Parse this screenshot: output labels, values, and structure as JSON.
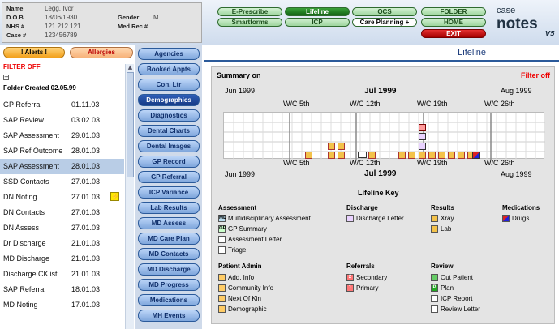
{
  "patient": {
    "name_label": "Name",
    "name": "Legg, Ivor",
    "dob_label": "D.O.B",
    "dob": "18/06/1930",
    "gender_label": "Gender",
    "gender": "M",
    "nhs_label": "NHS #",
    "nhs": "121 212 121",
    "medrec_label": "Med Rec #",
    "medrec": "",
    "case_label": "Case #",
    "case": "123456789"
  },
  "toolbar": {
    "eprescribe": "E-Prescribe",
    "lifeline": "Lifeline",
    "ocs": "OCS",
    "folder": "FOLDER",
    "smartforms": "Smartforms",
    "icp": "ICP",
    "care_planning": "Care Planning +",
    "home": "HOME",
    "exit": "EXIT"
  },
  "logo": {
    "text1": "case",
    "text2": "notes",
    "version": "V5"
  },
  "left": {
    "alerts": "! Alerts !",
    "allergies": "Allergies",
    "filter_off": "FILTER OFF",
    "collapse": "−",
    "folder_created": "Folder Created 02.05.99"
  },
  "list": [
    {
      "title": "GP Referral",
      "date": "01.11.03"
    },
    {
      "title": "SAP Review",
      "date": "03.02.03"
    },
    {
      "title": "SAP Assessment",
      "date": "29.01.03"
    },
    {
      "title": "SAP Ref Outcome",
      "date": "28.01.03"
    },
    {
      "title": "SAP Assessment",
      "date": "28.01.03"
    },
    {
      "title": "SSD Contacts",
      "date": "27.01.03"
    },
    {
      "title": "DN Noting",
      "date": "27.01.03",
      "icon": "alert-icon"
    },
    {
      "title": "DN Contacts",
      "date": "27.01.03"
    },
    {
      "title": "DN Assess",
      "date": "27.01.03"
    },
    {
      "title": "Dr Discharge",
      "date": "21.01.03"
    },
    {
      "title": "MD Discharge",
      "date": "21.01.03"
    },
    {
      "title": "Discharge CKlist",
      "date": "21.01.03"
    },
    {
      "title": "SAP Referral",
      "date": "18.01.03"
    },
    {
      "title": "MD Noting",
      "date": "17.01.03"
    },
    {
      "title": "",
      "date": ""
    }
  ],
  "nav": [
    "Agencies",
    "Booked Appts",
    "Con. Ltr",
    "Demographics",
    "Diagnostics",
    "Dental Charts",
    "Dental Images",
    "GP Record",
    "GP Referral",
    "ICP Variance",
    "Lab Results",
    "MD Assess",
    "MD Care Plan",
    "MD Contacts",
    "MD Discharge",
    "MD Progress",
    "Medications",
    "MH Events"
  ],
  "main": {
    "title": "Lifeline",
    "summary_on": "Summary on",
    "filter_off": "Filter off",
    "cal_top": {
      "left": "Jun 1999",
      "center": "Jul 1999",
      "right": "Aug 1999",
      "weeks": [
        "W/C 5th",
        "W/C 12th",
        "W/C 19th",
        "W/C 26th"
      ]
    },
    "cal_bottom": {
      "left": "Jun 1999",
      "center": "Jul 1999",
      "right": "Aug 1999",
      "weeks": [
        "W/C 5th",
        "W/C 12th",
        "W/C 19th",
        "W/C 26th"
      ]
    },
    "key_title": "Lifeline Key"
  },
  "key": {
    "assessment": {
      "title": "Assessment",
      "items": [
        "Multidisciplinary Assessment",
        "GP Summary",
        "Assessment Letter",
        "Triage"
      ]
    },
    "discharge": {
      "title": "Discharge",
      "items": [
        "Discharge Letter"
      ]
    },
    "results": {
      "title": "Results",
      "items": [
        "Xray",
        "Lab"
      ]
    },
    "medications": {
      "title": "Medications",
      "items": [
        "Drugs"
      ]
    },
    "patient_admin": {
      "title": "Patient Admin",
      "items": [
        "Add. Info",
        "Community Info",
        "Next Of Kin",
        "Demographic"
      ]
    },
    "referrals": {
      "title": "Referrals",
      "items": [
        "Secondary",
        "Primary"
      ],
      "icons": [
        "2",
        "1"
      ]
    },
    "review": {
      "title": "Review",
      "items": [
        "Out Patient",
        "Plan",
        "ICP Report",
        "Review Letter"
      ]
    }
  },
  "key_icon_codes": {
    "md": "MD",
    "gp": "GP",
    "plan": "P"
  }
}
